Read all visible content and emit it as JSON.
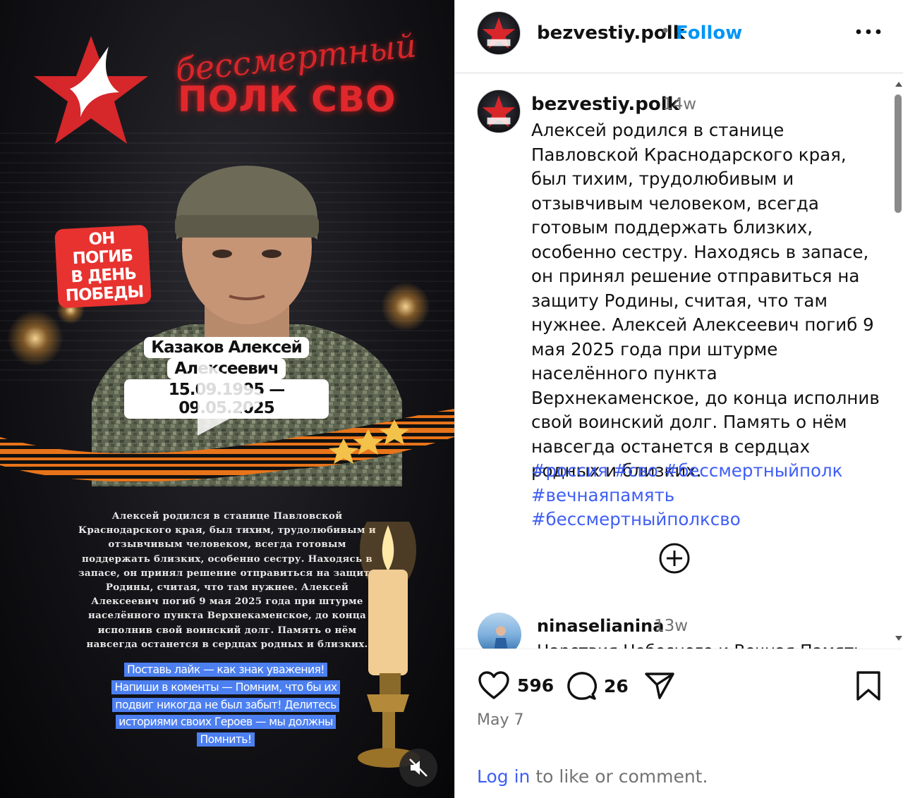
{
  "media": {
    "logo_script": "бессмертный",
    "logo_title": "ПОЛК СВО",
    "badge": [
      "ОН ПОГИБ",
      "В ДЕНЬ",
      "ПОБЕДЫ"
    ],
    "name_line1": "Казаков Алексей",
    "name_line2": "Алексеевич",
    "dates": "15.09.1995 — 09.05.2025",
    "bio_text": "Алексей родился в станице Павловской Краснодарского края, был тихим, трудолюбивым и отзывчивым человеком, всегда готовым поддержать близких, особенно сестру. Находясь в запасе, он принял решение отправиться на защиту Родины, считая, что там нужнее. Алексей Алексеевич погиб 9 мая 2025 года при штурме населённого пункта Верхнекаменское, до конца исполнив свой воинский долг. Память о нём навсегда останется в сердцах родных и близких.",
    "callouts": "Поставь лайк — как знак уважения! Напиши в коменты — Помним, что бы их подвиг никогда не был забыт! Делитесь историями своих Героев — мы должны Помнить!",
    "play_icon": "play-icon",
    "mute_icon": "speaker-muted-icon"
  },
  "header": {
    "username": "bezvestiy.polk",
    "separator": "•",
    "follow_label": "Follow",
    "more_icon": "more-horizontal-icon"
  },
  "caption": {
    "username": "bezvestiy.polk",
    "age": "14w",
    "text": "Алексей родился в станице Павловской Краснодарского края, был тихим, трудолюбивым и отзывчивым человеком, всегда готовым поддержать близких, особенно сестру. Находясь в запасе, он принял решение отправиться на защиту Родины, считая, что там нужнее. Алексей Алексеевич погиб 9 мая 2025 года при штурме населённого пункта Верхнекаменское, до конца исполнив свой воинский долг. Память о нём навсегда останется в сердцах родных и близких.",
    "hashtags": "#россия #сво #бессмертныйполк #вечнаяпамять #бессмертныйполксво"
  },
  "load_more_icon": "plus-circle-icon",
  "comment": {
    "username": "ninaselianina",
    "age": "13w",
    "text": "Царствия Небесного и Вечная Память"
  },
  "actions": {
    "likes": "596",
    "comments": "26",
    "date": "May 7",
    "login_link": "Log in",
    "login_rest": " to like or comment."
  },
  "colors": {
    "accent": "#0095f6",
    "hashtag": "#3f5ef5",
    "logo_red": "#e0282c",
    "callout_blue": "#4c7ff0"
  }
}
